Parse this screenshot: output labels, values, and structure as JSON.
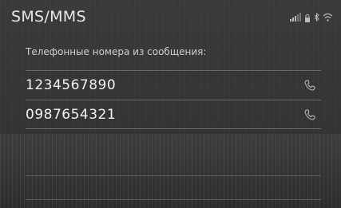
{
  "header": {
    "title": "SMS/MMS"
  },
  "content": {
    "subtitle": "Телефонные номера из сообщения:",
    "numbers": [
      {
        "number": "1234567890",
        "icon": "phone-icon"
      },
      {
        "number": "0987654321",
        "icon": "phone-icon"
      }
    ]
  },
  "status": {
    "icons": [
      "signal-icon",
      "lock-icon",
      "bluetooth-icon",
      "wifi-icon"
    ]
  },
  "colors": {
    "background": "#353535",
    "text": "#f2f2f2",
    "divider": "#6a6a6a"
  }
}
